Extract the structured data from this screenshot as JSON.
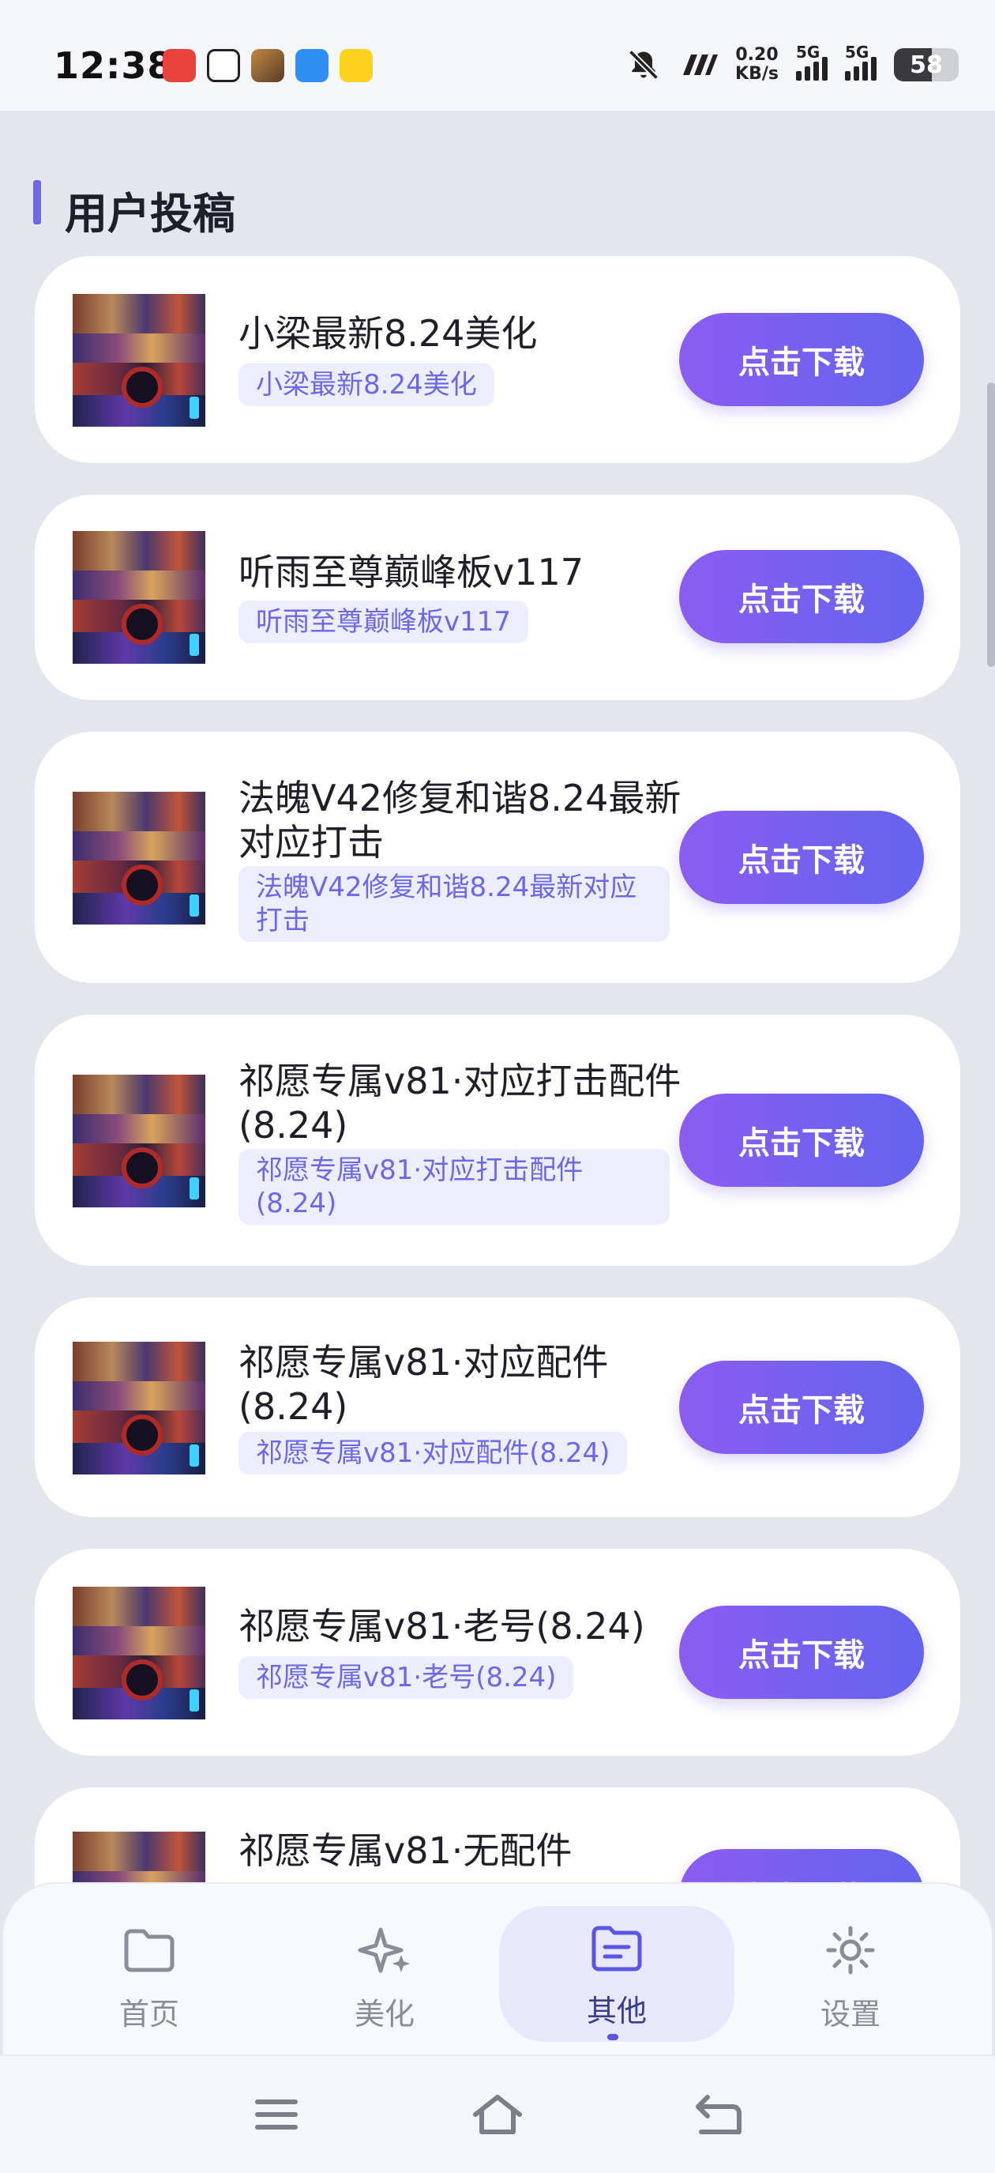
{
  "status_bar": {
    "time": "12:38",
    "net_speed_value": "0.20",
    "net_speed_unit": "KB/s",
    "sim1": "5G",
    "sim2": "5G",
    "battery": "58",
    "battery_level": 0.58,
    "notification_icons": [
      "app-icon-red",
      "app-icon-chat",
      "app-icon-game",
      "app-icon-blue",
      "app-icon-yellow"
    ],
    "status_icons": [
      "mute-icon",
      "hd-icon"
    ]
  },
  "section": {
    "title": "用户投稿"
  },
  "download_label": "点击下载",
  "items": [
    {
      "title": "小梁最新8.24美化",
      "tag": "小梁最新8.24美化"
    },
    {
      "title": "听雨至尊巅峰板v117",
      "tag": "听雨至尊巅峰板v117"
    },
    {
      "title": "法魄V42修复和谐8.24最新对应打击",
      "tag": "法魄V42修复和谐8.24最新对应打击"
    },
    {
      "title": "祁愿专属v81·对应打击配件(8.24)",
      "tag": "祁愿专属v81·对应打击配件(8.24)"
    },
    {
      "title": "祁愿专属v81·对应配件(8.24)",
      "tag": "祁愿专属v81·对应配件(8.24)"
    },
    {
      "title": "祁愿专属v81·老号(8.24)",
      "tag": "祁愿专属v81·老号(8.24)"
    },
    {
      "title": "祁愿专属v81·无配件",
      "tag": ""
    }
  ],
  "nav": {
    "items": [
      {
        "label": "首页",
        "icon": "folder-icon"
      },
      {
        "label": "美化",
        "icon": "sparkle-icon"
      },
      {
        "label": "其他",
        "icon": "document-folder-icon",
        "active": true
      },
      {
        "label": "设置",
        "icon": "gear-icon"
      }
    ]
  },
  "system_nav": [
    "menu-icon",
    "home-icon",
    "back-icon"
  ],
  "colors": {
    "accent": "#6d67ee",
    "button_start": "#8b5cf0",
    "button_end": "#6464ee",
    "tag_bg": "#eceefe",
    "tag_text": "#6c68e6"
  }
}
